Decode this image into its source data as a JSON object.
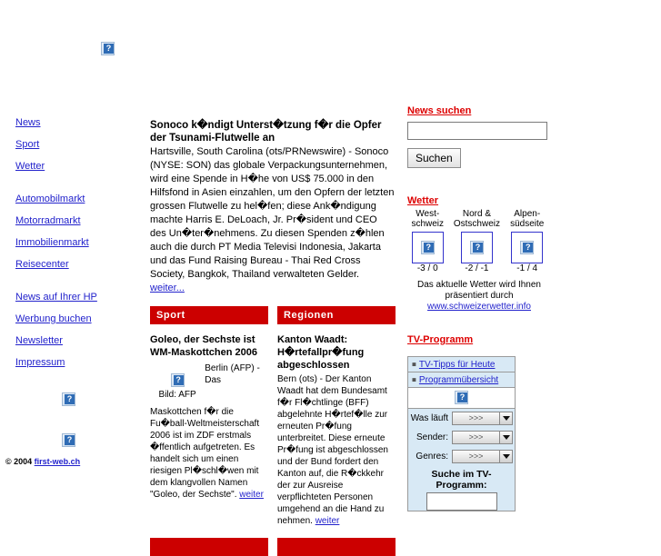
{
  "banner": {
    "icon": "broken-image-icon"
  },
  "sidebar": {
    "group1": [
      {
        "label": "News"
      },
      {
        "label": "Sport"
      },
      {
        "label": "Wetter"
      }
    ],
    "group2": [
      {
        "label": "Automobilmarkt"
      },
      {
        "label": "Motorradmarkt"
      },
      {
        "label": "Immobilienmarkt"
      },
      {
        "label": "Reisecenter"
      }
    ],
    "group3": [
      {
        "label": "News auf Ihrer HP"
      },
      {
        "label": "Werbung buchen"
      },
      {
        "label": "Newsletter"
      },
      {
        "label": "Impressum"
      }
    ],
    "ad1": "broken-image-icon",
    "ad2": "broken-image-icon",
    "copyright_prefix": "© 2004",
    "copyright_link": "first-web.ch"
  },
  "main": {
    "lead": {
      "headline": "Sonoco k�ndigt Unterst�tzung f�r die Opfer der Tsunami-Flutwelle an",
      "body": " Hartsville, South Carolina (ots/PRNewswire) - Sonoco (NYSE: SON) das globale Verpackungsunternehmen, wird eine Spende in H�he von US$ 75.000 in den Hilfsfond in Asien einzahlen, um den Opfern der letzten grossen Flutwelle zu hel�fen; diese Ank�ndigung machte Harris E. DeLoach, Jr. Pr�sident und CEO des Un�ter�nehmens. Zu diesen Spenden z�hlen auch die durch PT Media Televisi Indonesia, Jakarta und das Fund Raising Bureau - Thai Red Cross Society, Bangkok, Thailand verwalteten Gelder. ",
      "more_label": "weiter..."
    },
    "columns": [
      {
        "section_title": "Sport",
        "headline": "Goleo, der Sechste ist WM-Maskottchen 2006",
        "figure_caption": "Bild: AFP",
        "figure_icon": "broken-image-icon",
        "lead_in": "Berlin (AFP) - Das",
        "body": "Maskottchen f�r die Fu�ball-Weltmeisterschaft 2006 ist im ZDF erstmals �ffentlich aufgetreten. Es handelt sich um einen riesigen Pl�schl�wen mit dem klangvollen Namen \"Goleo, der Sechste\". ",
        "more_label": "weiter"
      },
      {
        "section_title": "Regionen",
        "headline": "Kanton Waadt: H�rtefallpr�fung abgeschlossen",
        "body": " Bern (ots) - Der Kanton Waadt hat dem Bundesamt f�r Fl�chtlinge (BFF) abgelehnte H�rtef�lle zur erneuten Pr�fung unterbreitet. Diese erneute Pr�fung ist abgeschlossen und der Bund fordert den Kanton auf, die R�ckkehr der zur Ausreise verpflichteten Personen umgehend an die Hand zu nehmen. ",
        "more_label": "weiter"
      }
    ],
    "bottom_sections": [
      {
        "section_title": ""
      },
      {
        "section_title": ""
      }
    ]
  },
  "right": {
    "search": {
      "title": "News suchen",
      "value": "",
      "placeholder": "",
      "button_label": "Suchen"
    },
    "weather": {
      "title": "Wetter",
      "regions": [
        {
          "name_line1": "West-",
          "name_line2": "schweiz",
          "icon": "broken-image-icon",
          "temperature": "-3 / 0"
        },
        {
          "name_line1": "Nord &",
          "name_line2": "Ostschweiz",
          "icon": "broken-image-icon",
          "temperature": "-2 / -1"
        },
        {
          "name_line1": "Alpen-",
          "name_line2": "südseite",
          "icon": "broken-image-icon",
          "temperature": "-1 / 4"
        }
      ],
      "credit_line1": "Das aktuelle Wetter wird Ihnen",
      "credit_line2": "präsentiert durch",
      "credit_link": "www.schweizerwetter.info"
    },
    "tv": {
      "title": "TV-Programm",
      "links": [
        {
          "label": "TV-Tipps für Heute"
        },
        {
          "label": "Programmübersicht"
        }
      ],
      "image_icon": "broken-image-icon",
      "selects": [
        {
          "label": "Was läuft",
          "value": ">>>"
        },
        {
          "label": "Sender:",
          "value": ">>>"
        },
        {
          "label": "Genres:",
          "value": ">>>"
        }
      ],
      "search_label": "Suche im TV-Programm:",
      "search_value": "",
      "search_placeholder": ""
    }
  },
  "colors": {
    "section_red": "#cc0000",
    "link_blue": "#2222cc",
    "red_link": "#dd0000",
    "tv_panel_bg": "#d8e9f5"
  }
}
